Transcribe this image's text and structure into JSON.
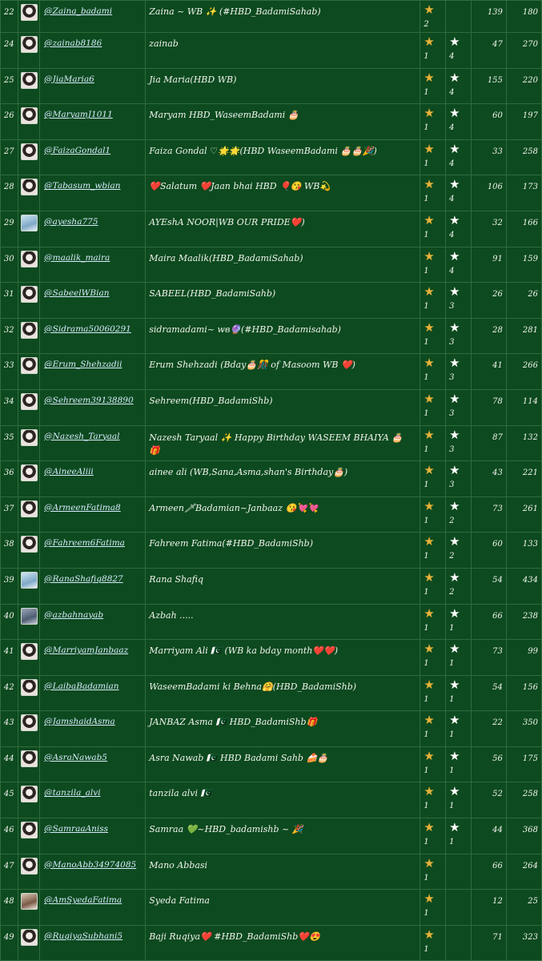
{
  "rows": [
    {
      "num": "22",
      "user": "@Zaina_badami",
      "name": "Zaina ~ WB ✨ (#HBD_BadamiSahab)",
      "g": "2",
      "s": "",
      "white": false,
      "n1": "139",
      "n2": "180"
    },
    {
      "num": "24",
      "user": "@zainab8186",
      "name": "zainab",
      "g": "1",
      "s": "4",
      "white": true,
      "n1": "47",
      "n2": "270"
    },
    {
      "num": "25",
      "user": "@JiaMaria6",
      "name": "Jia Maria(HBD WB)",
      "g": "1",
      "s": "4",
      "white": true,
      "n1": "155",
      "n2": "220"
    },
    {
      "num": "26",
      "user": "@MaryamJ1011",
      "name": "Maryam HBD_WaseemBadami 🎂",
      "g": "1",
      "s": "4",
      "white": true,
      "n1": "60",
      "n2": "197"
    },
    {
      "num": "27",
      "user": "@FaizaGondal1",
      "name": "Faiza Gondal ♡🌟🌟(HBD WaseemBadami 🎂🎂🎉)",
      "g": "1",
      "s": "4",
      "white": true,
      "n1": "33",
      "n2": "258"
    },
    {
      "num": "28",
      "user": "@Tabasum_wbian",
      "name": "❤️Salatum ❤️Jaan bhai HBD 🎈😘 WB💫",
      "g": "1",
      "s": "4",
      "white": true,
      "n1": "106",
      "n2": "173"
    },
    {
      "num": "29",
      "user": "@ayesha775",
      "name": "AYEshA NOOR|WB OUR PRIDE❤️)",
      "g": "1",
      "s": "4",
      "white": true,
      "n1": "32",
      "n2": "166"
    },
    {
      "num": "30",
      "user": "@maalik_maira",
      "name": "Maira Maalik(HBD_BadamiSahab)",
      "g": "1",
      "s": "4",
      "white": true,
      "n1": "91",
      "n2": "159"
    },
    {
      "num": "31",
      "user": "@SabeelWBian",
      "name": "SABEEL(HBD_BadamiSahb)",
      "g": "1",
      "s": "3",
      "white": true,
      "n1": "26",
      "n2": "26"
    },
    {
      "num": "32",
      "user": "@Sidrama50060291",
      "name": "sidramadami~ wв🔮(#HBD_Badamisahab)",
      "g": "1",
      "s": "3",
      "white": true,
      "n1": "28",
      "n2": "281"
    },
    {
      "num": "33",
      "user": "@Erum_Shehzadii",
      "name": "Erum Shehzadi (Bday🎂🎊 of Masoom WB ❤️)",
      "g": "1",
      "s": "3",
      "white": true,
      "n1": "41",
      "n2": "266"
    },
    {
      "num": "34",
      "user": "@Sehreem39138890",
      "name": "Sehreem(HBD_BadamiShb)",
      "g": "1",
      "s": "3",
      "white": true,
      "n1": "78",
      "n2": "114"
    },
    {
      "num": "35",
      "user": "@Nazesh_Taryaal",
      "name": "Nazesh Taryaal ✨ Happy Birthday WASEEM BHAIYA 🎂🎁",
      "g": "1",
      "s": "3",
      "white": true,
      "n1": "87",
      "n2": "132"
    },
    {
      "num": "36",
      "user": "@AineeAliii",
      "name": "ainee ali (WB,Sana,Asma,shan's Birthday🎂)",
      "g": "1",
      "s": "3",
      "white": true,
      "n1": "43",
      "n2": "221"
    },
    {
      "num": "37",
      "user": "@ArmeenFatima8",
      "name": "Armeen🗡Badamian~Janbaaz 😘💘💘",
      "g": "1",
      "s": "2",
      "white": true,
      "n1": "73",
      "n2": "261"
    },
    {
      "num": "38",
      "user": "@Fahreem6Fatima",
      "name": "Fahreem Fatima(#HBD_BadamiShb)",
      "g": "1",
      "s": "2",
      "white": true,
      "n1": "60",
      "n2": "133"
    },
    {
      "num": "39",
      "user": "@RanaShafiq8827",
      "name": "Rana Shafiq",
      "g": "1",
      "s": "2",
      "white": true,
      "n1": "54",
      "n2": "434"
    },
    {
      "num": "40",
      "user": "@azbahnayab",
      "name": "Azbah .....",
      "g": "1",
      "s": "1",
      "white": true,
      "n1": "66",
      "n2": "238"
    },
    {
      "num": "41",
      "user": "@MarriyamJanbaaz",
      "name": "Marriyam Ali 🇵🇰 (WB ka bday month❤️❤️)",
      "g": "1",
      "s": "1",
      "white": true,
      "n1": "73",
      "n2": "99"
    },
    {
      "num": "42",
      "user": "@LaibaBadamian",
      "name": "WaseemBadami ki Behna🤗(HBD_BadamiShb)",
      "g": "1",
      "s": "1",
      "white": true,
      "n1": "54",
      "n2": "156"
    },
    {
      "num": "43",
      "user": "@JamshaidAsma",
      "name": "JANBAZ Asma 🇵🇰 HBD_BadamiShb🎁",
      "g": "1",
      "s": "1",
      "white": true,
      "n1": "22",
      "n2": "350"
    },
    {
      "num": "44",
      "user": "@AsraNawab5",
      "name": "Asra Nawab 🇵🇰 HBD Badami Sahb 🍰🎂",
      "g": "1",
      "s": "1",
      "white": true,
      "n1": "56",
      "n2": "175"
    },
    {
      "num": "45",
      "user": "@tanzila_alvi",
      "name": "tanzila alvi 🇵🇰",
      "g": "1",
      "s": "1",
      "white": true,
      "n1": "52",
      "n2": "258"
    },
    {
      "num": "46",
      "user": "@SamraaAniss",
      "name": "Samraa 💚~HBD_badamishb ~ 🎉",
      "g": "1",
      "s": "1",
      "white": true,
      "n1": "44",
      "n2": "368"
    },
    {
      "num": "47",
      "user": "@ManoAbb34974085",
      "name": "Mano Abbasi",
      "g": "1",
      "s": "",
      "white": false,
      "n1": "66",
      "n2": "264"
    },
    {
      "num": "48",
      "user": "@AmSyedaFatima",
      "name": "Syeda Fatima",
      "g": "1",
      "s": "",
      "white": false,
      "n1": "12",
      "n2": "25"
    },
    {
      "num": "49",
      "user": "@RuqiyaSubhani5",
      "name": "Baji Ruqiya❤️ #HBD_BadamiShb❤️😍",
      "g": "1",
      "s": "",
      "white": false,
      "n1": "71",
      "n2": "323"
    }
  ],
  "icons": {
    "gold": "star-icon-gold",
    "white": "star-icon-white"
  },
  "colors": {
    "background": "#0d4a1f",
    "border": "#2f6b3c",
    "link": "#d8ecff",
    "gold_star": "#e8b23a"
  }
}
